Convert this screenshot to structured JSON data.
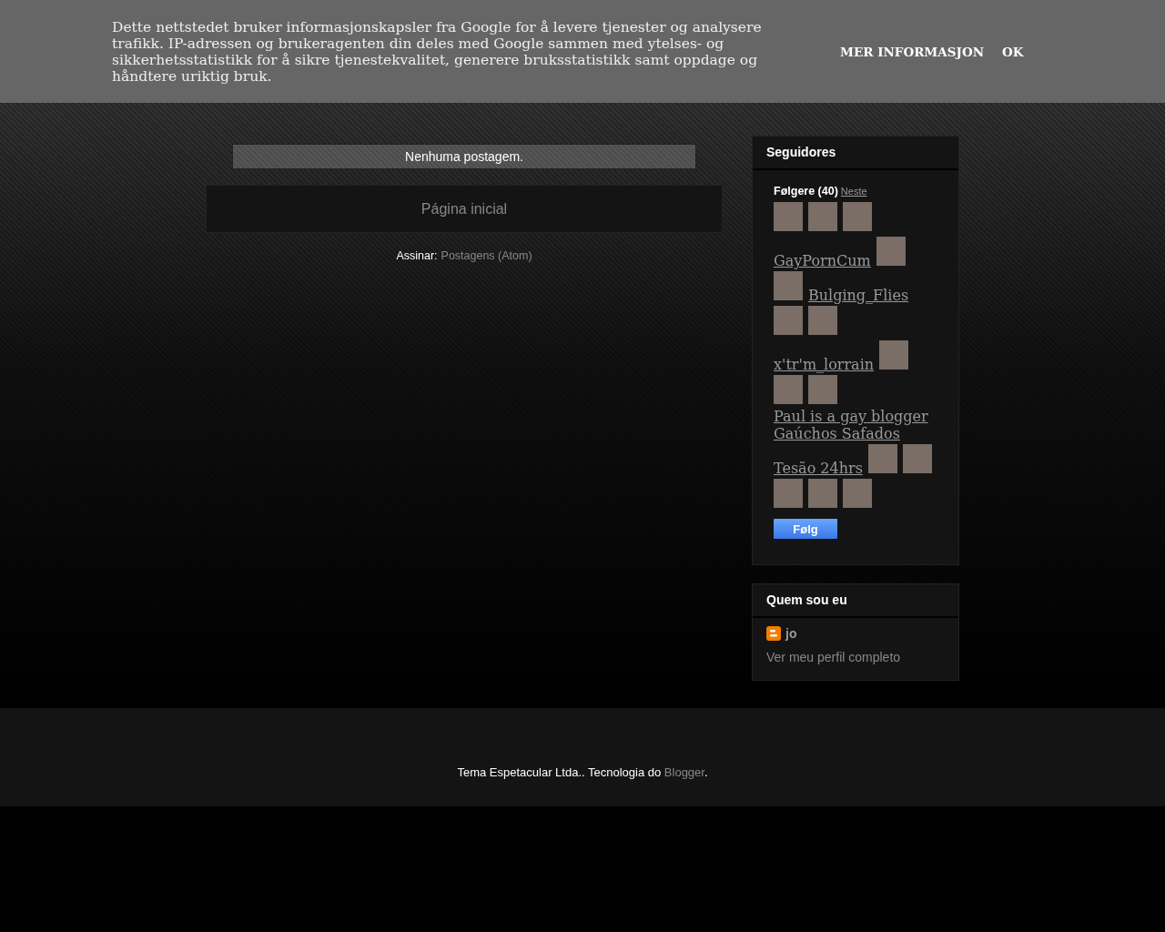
{
  "cookie_notice": {
    "text": "Dette nettstedet bruker informasjonskapsler fra Google for å levere tjenester og analysere trafikk. IP-adressen og brukeragenten din deles med Google sammen med ytelses- og sikkerhetsstatistikk for å sikre tjenestekvalitet, generere bruksstatistikk samt oppdage og håndtere uriktig bruk.",
    "buttons": [
      "MER INFORMASJON",
      "OK"
    ]
  },
  "main": {
    "status_message": "Nenhuma postagem.",
    "home_link": "Página inicial",
    "subscribe_label": "Assinar:",
    "subscribe_link": "Postagens (Atom)"
  },
  "followers": {
    "title": "Seguidores",
    "count_label": "Følgere (40)",
    "next_link": "Neste",
    "follow_button": "Følg",
    "items": [
      {
        "kind": "avatar"
      },
      {
        "kind": "avatar"
      },
      {
        "kind": "avatar"
      },
      {
        "kind": "name",
        "text": "GayPornCum"
      },
      {
        "kind": "avatar"
      },
      {
        "kind": "avatar"
      },
      {
        "kind": "name",
        "text": "Bulging_Flies"
      },
      {
        "kind": "avatar"
      },
      {
        "kind": "avatar"
      },
      {
        "kind": "name",
        "text": "x'tr'm_lorrain"
      },
      {
        "kind": "avatar"
      },
      {
        "kind": "avatar"
      },
      {
        "kind": "avatar"
      },
      {
        "kind": "name",
        "text": "Paul is a gay blogger"
      },
      {
        "kind": "name",
        "text": "Gaúchos Safados"
      },
      {
        "kind": "name",
        "text": "Tesão 24hrs"
      },
      {
        "kind": "avatar"
      },
      {
        "kind": "avatar"
      },
      {
        "kind": "avatar"
      },
      {
        "kind": "avatar"
      },
      {
        "kind": "avatar"
      }
    ]
  },
  "profile": {
    "title": "Quem sou eu",
    "name": "jo",
    "profile_link": "Ver meu perfil completo"
  },
  "footer": {
    "text": "Tema Espetacular Ltda.. Tecnologia do",
    "link": "Blogger",
    "end": "."
  }
}
